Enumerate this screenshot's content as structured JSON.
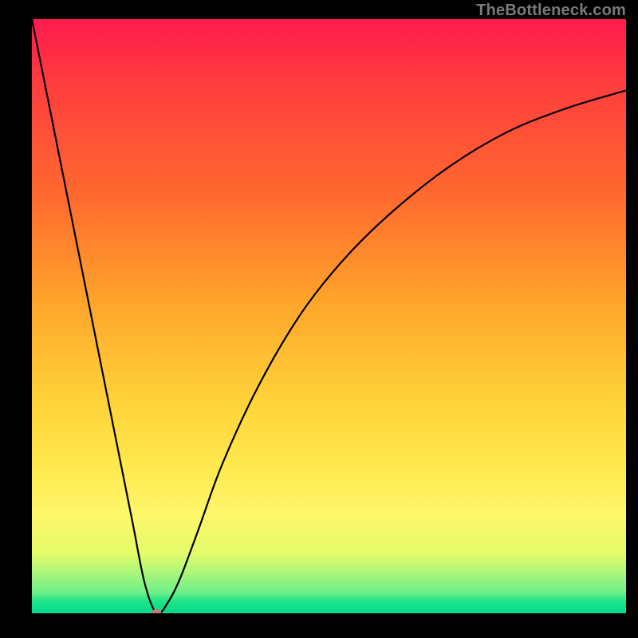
{
  "attribution": "TheBottleneck.com",
  "chart_data": {
    "type": "line",
    "title": "",
    "xlabel": "",
    "ylabel": "",
    "xlim": [
      0,
      100
    ],
    "ylim": [
      0,
      100
    ],
    "grid": false,
    "series": [
      {
        "name": "bottleneck-curve",
        "x": [
          0,
          5,
          10,
          15,
          17,
          19,
          21,
          23,
          25,
          28,
          32,
          38,
          45,
          52,
          60,
          70,
          80,
          90,
          100
        ],
        "values": [
          100,
          75,
          50,
          25,
          15,
          5,
          0,
          2,
          6,
          14,
          25,
          38,
          50,
          59,
          67,
          75,
          81,
          85,
          88
        ]
      }
    ],
    "annotations": [
      {
        "name": "optimal-point",
        "x": 21,
        "y": 0
      }
    ],
    "background_gradient": {
      "direction": "vertical",
      "stops": [
        {
          "pos": 0.0,
          "color": "#ff1a4d"
        },
        {
          "pos": 0.5,
          "color": "#ffb531"
        },
        {
          "pos": 0.82,
          "color": "#fff15a"
        },
        {
          "pos": 1.0,
          "color": "#06d693"
        }
      ]
    }
  }
}
